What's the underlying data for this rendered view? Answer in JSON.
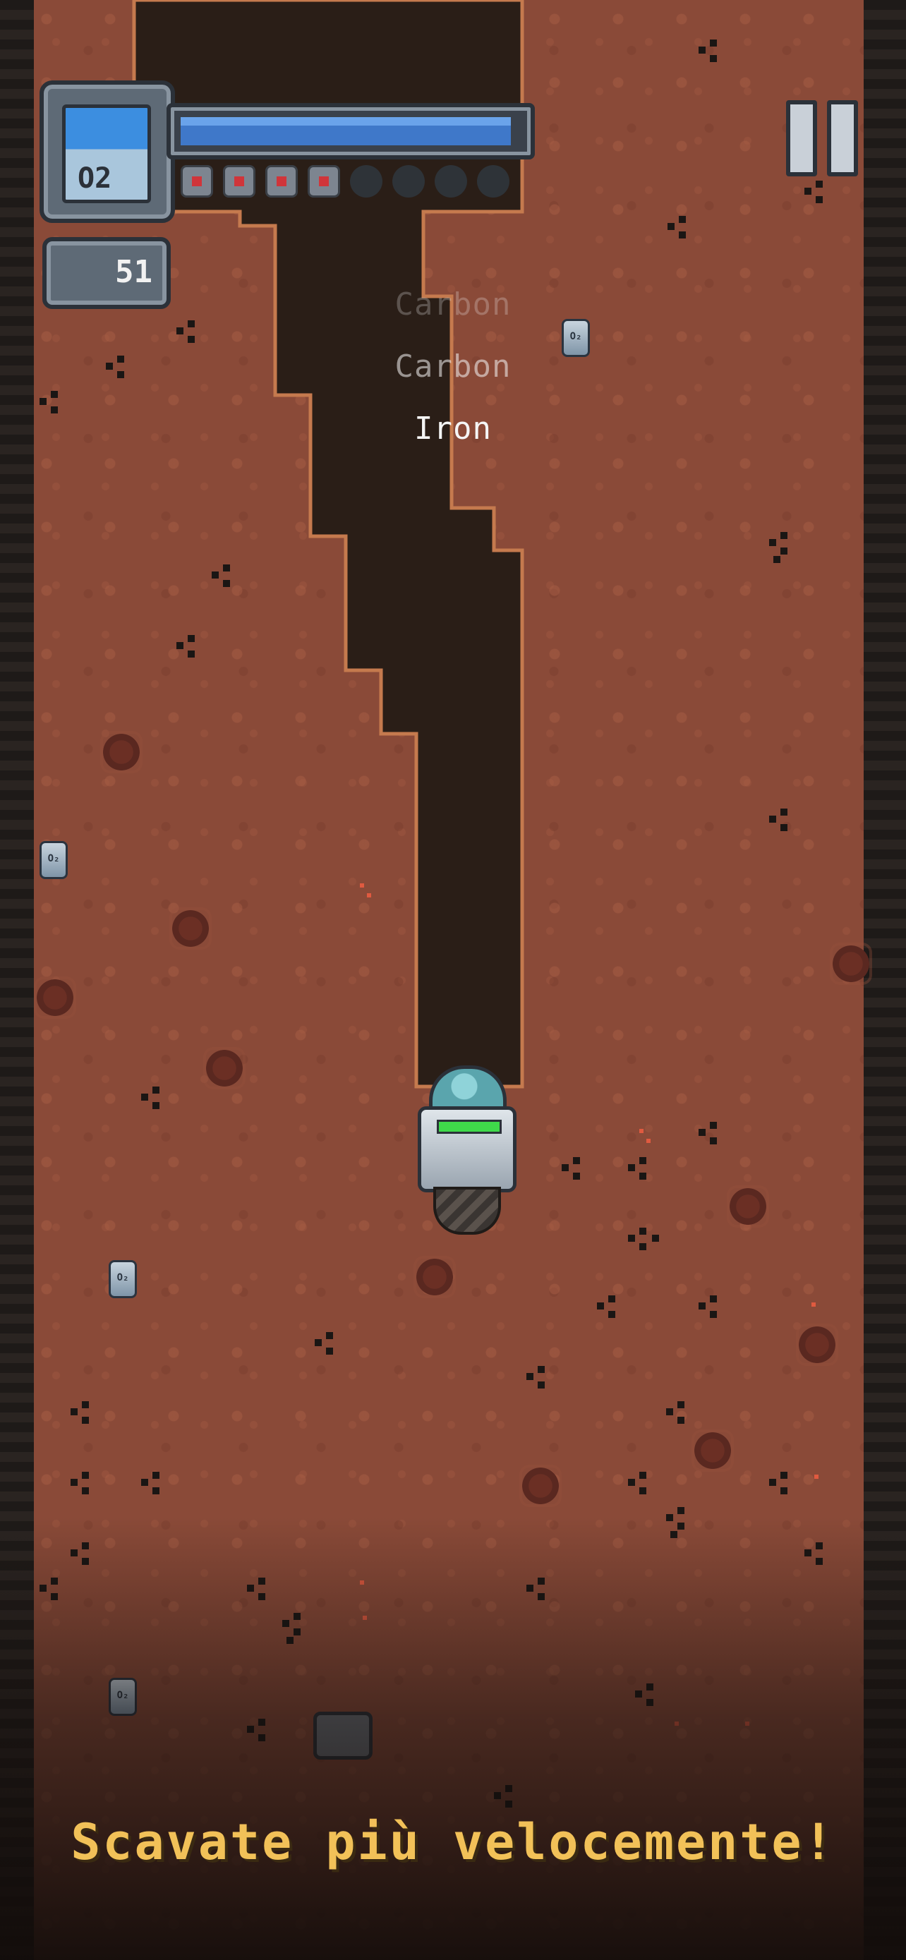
{
  "hud": {
    "oxygen_label": "O2",
    "oxygen_level": 0.97,
    "fuel_cells": [
      true,
      true,
      true,
      true,
      false,
      false,
      false,
      false
    ],
    "depth_value": "51",
    "pause_label": "pause"
  },
  "pickups": [
    {
      "text": "Carbon",
      "opacity": 0.25
    },
    {
      "text": "Carbon",
      "opacity": 0.55
    },
    {
      "text": "Iron",
      "opacity": 1.0
    }
  ],
  "caption": "Scavate più velocemente!",
  "icons": {
    "oxygen_tank": "oxygen-tank-icon",
    "pause": "pause-icon",
    "robot": "drill-robot-icon",
    "canister": "oxygen-canister-icon",
    "rock": "hard-rock-icon",
    "coal": "coal-ore-icon"
  },
  "colors": {
    "dirt": "#8a4a38",
    "tunnel": "#2a1e17",
    "caption": "#f2c158",
    "oxygen_fill": "#3f78c9",
    "cell_active": "#d0353a"
  }
}
